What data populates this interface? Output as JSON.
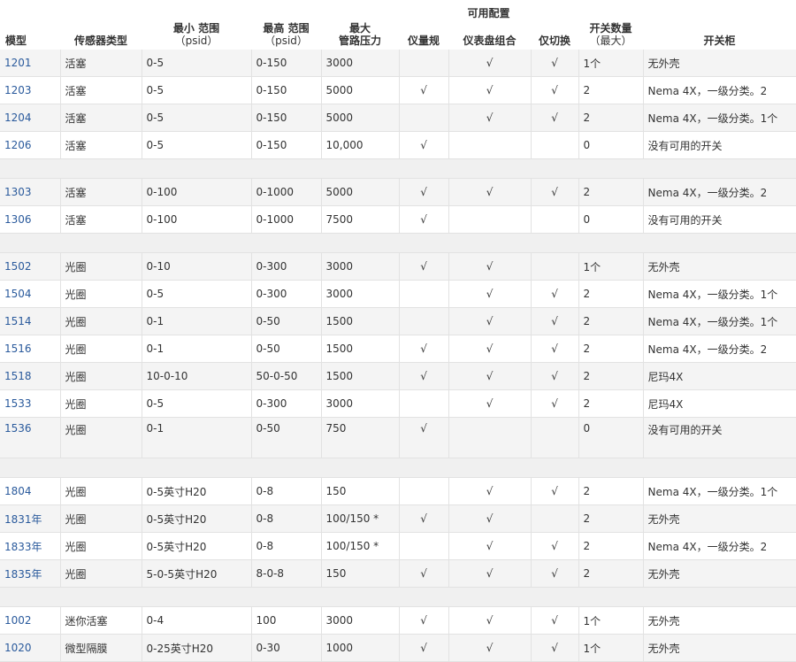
{
  "header": {
    "available_config": "可用配置",
    "model": "模型",
    "sensor_type": "传感器类型",
    "min_range": "最小 范围",
    "min_range_unit": "（psid）",
    "max_range": "最高 范围",
    "max_range_unit": "（psid）",
    "max_pressure_line1": "最大",
    "max_pressure_line2": "管路压力",
    "gauge_only": "仪量规",
    "panel_combo": "仪表盘组合",
    "switch_only": "仅切换",
    "switch_count": "开关数量",
    "switch_count_sub": "（最大）",
    "enclosure": "开关柜"
  },
  "rows": [
    {
      "model": "1201",
      "type": "活塞",
      "min": "0-5",
      "max": "0-150",
      "pressure": "3000",
      "gauge": "",
      "combo": "√",
      "switch": "√",
      "count": "1个",
      "case": "无外壳"
    },
    {
      "model": "1203",
      "type": "活塞",
      "min": "0-5",
      "max": "0-150",
      "pressure": "5000",
      "gauge": "√",
      "combo": "√",
      "switch": "√",
      "count": "2",
      "case": "Nema 4X，一级分类。2"
    },
    {
      "model": "1204",
      "type": "活塞",
      "min": "0-5",
      "max": "0-150",
      "pressure": "5000",
      "gauge": "",
      "combo": "√",
      "switch": "√",
      "count": "2",
      "case": "Nema 4X，一级分类。1个"
    },
    {
      "model": "1206",
      "type": "活塞",
      "min": "0-5",
      "max": "0-150",
      "pressure": "10,000",
      "gauge": "√",
      "combo": "",
      "switch": "",
      "count": "0",
      "case": "没有可用的开关"
    },
    {
      "spacer": true
    },
    {
      "model": "1303",
      "type": "活塞",
      "min": "0-100",
      "max": "0-1000",
      "pressure": "5000",
      "gauge": "√",
      "combo": "√",
      "switch": "√",
      "count": "2",
      "case": "Nema 4X，一级分类。2"
    },
    {
      "model": "1306",
      "type": "活塞",
      "min": "0-100",
      "max": "0-1000",
      "pressure": "7500",
      "gauge": "√",
      "combo": "",
      "switch": "",
      "count": "0",
      "case": "没有可用的开关"
    },
    {
      "spacer": true
    },
    {
      "model": "1502",
      "type": "光圈",
      "min": "0-10",
      "max": "0-300",
      "pressure": "3000",
      "gauge": "√",
      "combo": "√",
      "switch": "",
      "count": "1个",
      "case": "无外壳"
    },
    {
      "model": "1504",
      "type": "光圈",
      "min": "0-5",
      "max": "0-300",
      "pressure": "3000",
      "gauge": "",
      "combo": "√",
      "switch": "√",
      "count": "2",
      "case": "Nema 4X，一级分类。1个"
    },
    {
      "model": "1514",
      "type": "光圈",
      "min": "0-1",
      "max": "0-50",
      "pressure": "1500",
      "gauge": "",
      "combo": "√",
      "switch": "√",
      "count": "2",
      "case": "Nema 4X，一级分类。1个"
    },
    {
      "model": "1516",
      "type": "光圈",
      "min": "0-1",
      "max": "0-50",
      "pressure": "1500",
      "gauge": "√",
      "combo": "√",
      "switch": "√",
      "count": "2",
      "case": "Nema 4X，一级分类。2"
    },
    {
      "model": "1518",
      "type": "光圈",
      "min": "10-0-10",
      "max": "50-0-50",
      "pressure": "1500",
      "gauge": "√",
      "combo": "√",
      "switch": "√",
      "count": "2",
      "case": "尼玛4X"
    },
    {
      "model": "1533",
      "type": "光圈",
      "min": "0-5",
      "max": "0-300",
      "pressure": "3000",
      "gauge": "",
      "combo": "√",
      "switch": "√",
      "count": "2",
      "case": "尼玛4X"
    },
    {
      "model": "1536",
      "type": "光圈",
      "min": "0-1",
      "max": "0-50",
      "pressure": "750",
      "gauge": "√",
      "combo": "",
      "switch": "",
      "count": "0",
      "case": "没有可用的开关",
      "tall": true
    },
    {
      "spacer": true
    },
    {
      "model": "1804",
      "type": "光圈",
      "min": "0-5英寸H20",
      "max": "0-8",
      "pressure": "150",
      "gauge": "",
      "combo": "√",
      "switch": "√",
      "count": "2",
      "case": "Nema 4X，一级分类。1个"
    },
    {
      "model": "1831年",
      "type": "光圈",
      "min": "0-5英寸H20",
      "max": "0-8",
      "pressure": "100/150 *",
      "gauge": "√",
      "combo": "√",
      "switch": "",
      "count": "2",
      "case": "无外壳"
    },
    {
      "model": "1833年",
      "type": "光圈",
      "min": "0-5英寸H20",
      "max": "0-8",
      "pressure": "100/150 *",
      "gauge": "",
      "combo": "√",
      "switch": "√",
      "count": "2",
      "case": "Nema 4X，一级分类。2"
    },
    {
      "model": "1835年",
      "type": "光圈",
      "min": "5-0-5英寸H20",
      "max": "8-0-8",
      "pressure": "150",
      "gauge": "√",
      "combo": "√",
      "switch": "√",
      "count": "2",
      "case": "无外壳"
    },
    {
      "spacer": true
    },
    {
      "model": "1002",
      "type": "迷你活塞",
      "min": "0-4",
      "max": "100",
      "pressure": "3000",
      "gauge": "√",
      "combo": "√",
      "switch": "√",
      "count": "1个",
      "case": "无外壳"
    },
    {
      "model": "1020",
      "type": "微型隔膜",
      "min": "0-25英寸H20",
      "max": "0-30",
      "pressure": "1000",
      "gauge": "√",
      "combo": "√",
      "switch": "√",
      "count": "1个",
      "case": "无外壳"
    }
  ]
}
